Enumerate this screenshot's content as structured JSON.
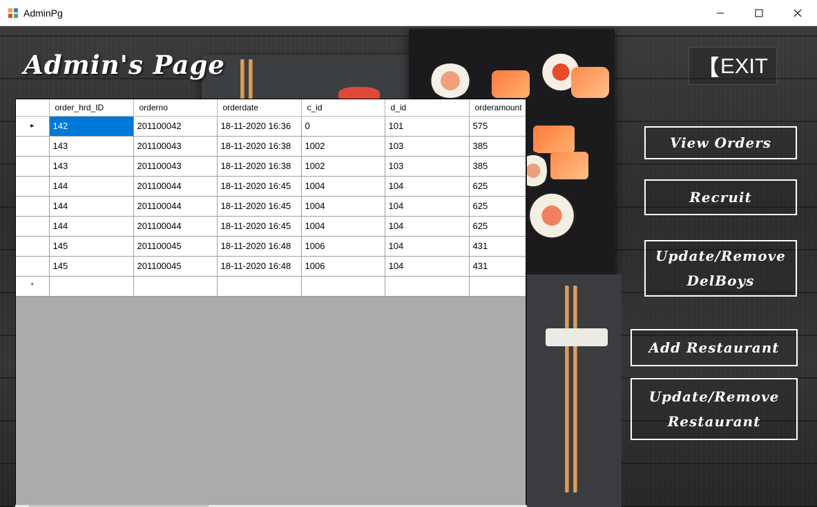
{
  "window": {
    "title": "AdminPg"
  },
  "heading": "Admin's Page",
  "exit": {
    "bracket": "【",
    "label": "EXIT"
  },
  "buttons": {
    "view_orders": "View Orders",
    "recruit": "Recruit",
    "update_remove_delboys_line1": "Update/Remove",
    "update_remove_delboys_line2": "DelBoys",
    "add_restaurant": "Add Restaurant",
    "update_remove_restaurant_line1": "Update/Remove",
    "update_remove_restaurant_line2": "Restaurant"
  },
  "table": {
    "columns": [
      "order_hrd_ID",
      "orderno",
      "orderdate",
      "c_id",
      "d_id",
      "orderamount"
    ],
    "rows": [
      [
        "142",
        "201100042",
        "18-11-2020 16:36",
        "0",
        "101",
        "575"
      ],
      [
        "143",
        "201100043",
        "18-11-2020 16:38",
        "1002",
        "103",
        "385"
      ],
      [
        "143",
        "201100043",
        "18-11-2020 16:38",
        "1002",
        "103",
        "385"
      ],
      [
        "144",
        "201100044",
        "18-11-2020 16:45",
        "1004",
        "104",
        "625"
      ],
      [
        "144",
        "201100044",
        "18-11-2020 16:45",
        "1004",
        "104",
        "625"
      ],
      [
        "144",
        "201100044",
        "18-11-2020 16:45",
        "1004",
        "104",
        "625"
      ],
      [
        "145",
        "201100045",
        "18-11-2020 16:48",
        "1006",
        "104",
        "431"
      ],
      [
        "145",
        "201100045",
        "18-11-2020 16:48",
        "1006",
        "104",
        "431"
      ]
    ],
    "current_row_marker": "▸",
    "new_row_marker": "*"
  },
  "colors": {
    "selection": "#0078d7",
    "grid_background": "#ababab"
  }
}
